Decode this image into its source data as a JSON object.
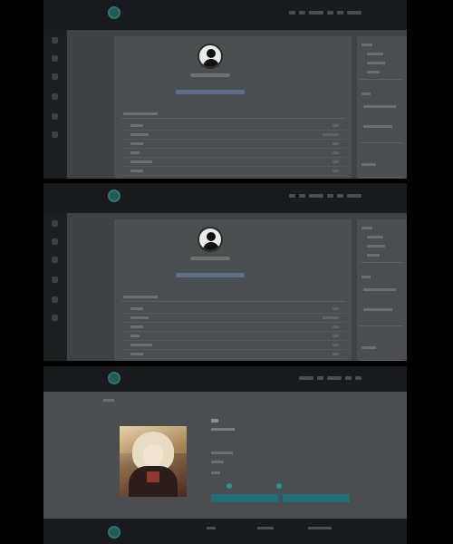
{
  "screens": [
    {
      "id": "profile-settings-1"
    },
    {
      "id": "profile-settings-2"
    },
    {
      "id": "profile-detail"
    }
  ],
  "colors": {
    "accent": "#2a8f99",
    "topbar": "#181a1b",
    "link": "#58708a"
  },
  "icons": {
    "logo": "app-logo-icon",
    "avatar": "user-avatar-icon",
    "rail": [
      "home-icon",
      "document-icon",
      "clock-icon",
      "chart-icon",
      "folder-icon",
      "settings-icon"
    ]
  }
}
